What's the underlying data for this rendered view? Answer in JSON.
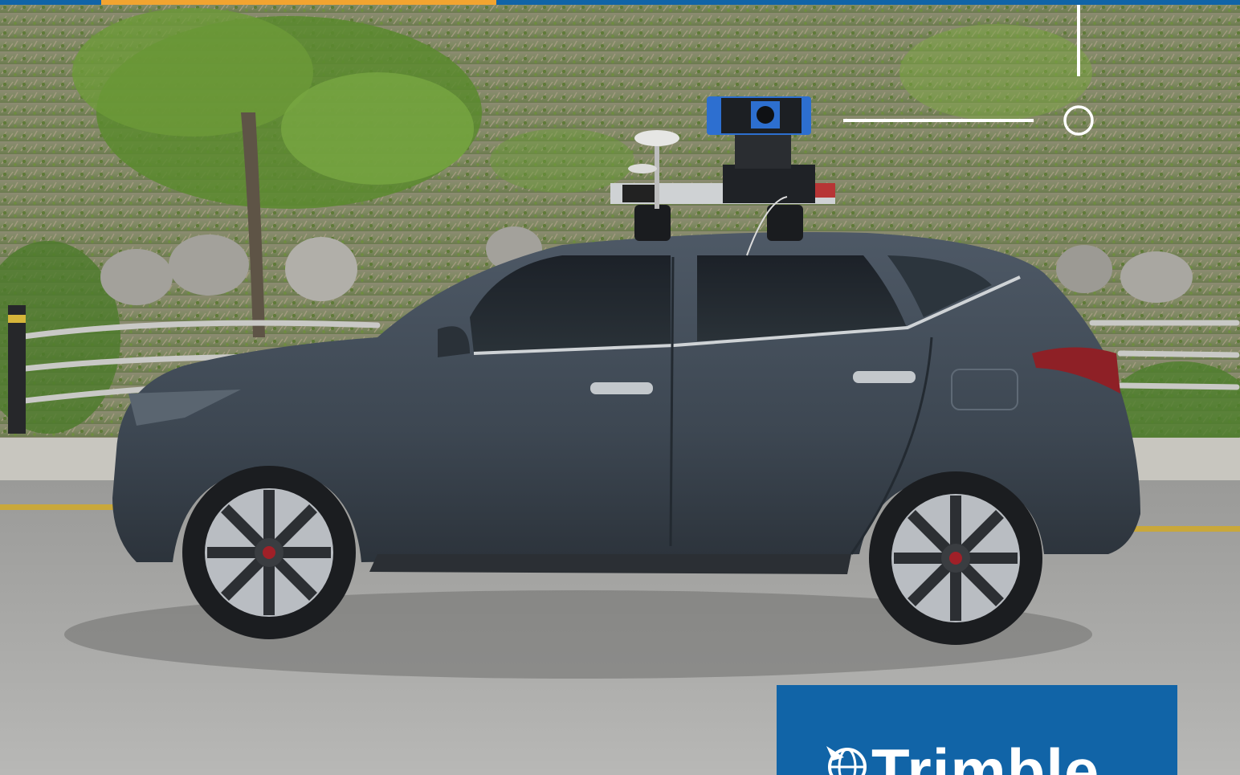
{
  "scene": {
    "description_colors": {
      "brand_blue": "#1164a7",
      "accent_orange": "#f2a430",
      "car_body": "#3f4a56"
    }
  },
  "logo": {
    "wordmark": "Trimble",
    "icon": "trimble-globe-icon"
  }
}
